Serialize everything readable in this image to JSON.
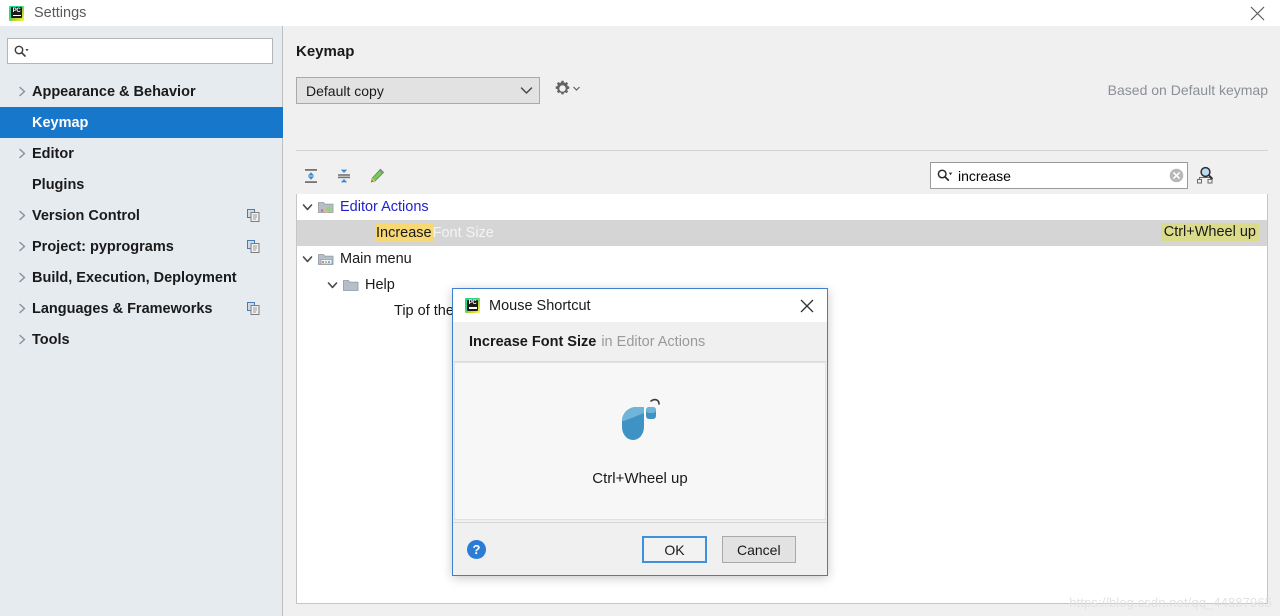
{
  "window": {
    "title": "Settings",
    "logo": "pycharm-logo",
    "close_icon": "close-icon"
  },
  "sidebar": {
    "search": {
      "value": "",
      "placeholder": "",
      "icon": "search-icon"
    },
    "items": [
      {
        "label": "Appearance & Behavior",
        "expandable": true,
        "selected": false,
        "badge": false
      },
      {
        "label": "Keymap",
        "expandable": false,
        "selected": true,
        "badge": false
      },
      {
        "label": "Editor",
        "expandable": true,
        "selected": false,
        "badge": false
      },
      {
        "label": "Plugins",
        "expandable": false,
        "selected": false,
        "badge": false
      },
      {
        "label": "Version Control",
        "expandable": true,
        "selected": false,
        "badge": true
      },
      {
        "label": "Project: pyprograms",
        "expandable": true,
        "selected": false,
        "badge": true
      },
      {
        "label": "Build, Execution, Deployment",
        "expandable": true,
        "selected": false,
        "badge": false
      },
      {
        "label": "Languages & Frameworks",
        "expandable": true,
        "selected": false,
        "badge": true
      },
      {
        "label": "Tools",
        "expandable": true,
        "selected": false,
        "badge": false
      }
    ]
  },
  "main": {
    "title": "Keymap",
    "keymap_select": {
      "value": "Default copy",
      "arrow_icon": "chevron-down-icon"
    },
    "gear_icon": "gear-dropdown-icon",
    "based_on": "Based on Default keymap",
    "toolbar": [
      {
        "name": "expand-all-button",
        "icon": "expand-all-icon"
      },
      {
        "name": "collapse-all-button",
        "icon": "collapse-all-icon"
      },
      {
        "name": "edit-shortcut-button",
        "icon": "pencil-icon"
      }
    ],
    "tree_search": {
      "value": "increase",
      "placeholder": "",
      "icon": "search-icon",
      "clear_icon": "clear-circle-icon"
    },
    "shortcut_filter": {
      "name": "filter-by-shortcut-button",
      "icon": "find-shortcut-icon"
    },
    "tree": [
      {
        "label": "Editor Actions",
        "indent": 0,
        "twisty": "chevron-down-icon",
        "icon": "editor-actions-folder-icon",
        "link": true,
        "selected": false,
        "shortcut": ""
      },
      {
        "label": "Increase Font Size",
        "match": "Increase",
        "rest": " Font Size",
        "indent": 2,
        "twisty": "",
        "icon": "",
        "link": false,
        "selected": true,
        "shortcut": "Ctrl+Wheel up"
      },
      {
        "label": "Main menu",
        "indent": 0,
        "twisty": "chevron-down-icon",
        "icon": "main-menu-folder-icon",
        "link": false,
        "selected": false,
        "shortcut": ""
      },
      {
        "label": "Help",
        "indent": 1,
        "twisty": "chevron-down-icon",
        "icon": "folder-icon",
        "link": false,
        "selected": false,
        "shortcut": ""
      },
      {
        "label": "Tip of the Day",
        "indent": 3,
        "twisty": "",
        "icon": "",
        "link": false,
        "selected": false,
        "shortcut": ""
      }
    ]
  },
  "dialog": {
    "title": "Mouse Shortcut",
    "logo": "pycharm-logo",
    "close_icon": "close-icon",
    "action_name": "Increase Font Size",
    "action_context": "in Editor Actions",
    "mouse_icon": "mouse-wheel-icon",
    "shortcut_text": "Ctrl+Wheel up",
    "help_label": "?",
    "ok_label": "OK",
    "cancel_label": "Cancel"
  },
  "watermark": "https://blog.csdn.net/qq_44887965",
  "colors": {
    "accent": "#1777cb",
    "selection_bg": "#1777cb",
    "row_selected": "#d5d5d5",
    "search_match": "#f7d873",
    "shortcut_match": "#dbdb8c",
    "link": "#2222cc",
    "dialog_border": "#3f7fcf"
  }
}
